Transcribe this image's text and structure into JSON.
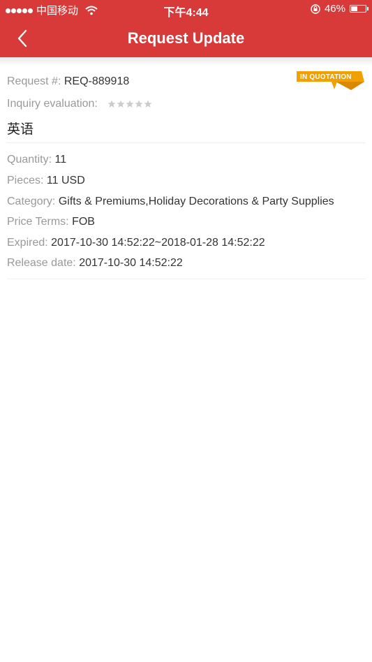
{
  "status_bar": {
    "carrier": "中国移动",
    "time": "下午4:44",
    "battery_percent": "46%",
    "battery_level": 0.46,
    "icons": [
      "signal-dots-icon",
      "wifi-icon",
      "rotation-lock-icon",
      "battery-icon"
    ]
  },
  "nav": {
    "title": "Request Update",
    "back_icon": "chevron-left-icon"
  },
  "request": {
    "badge": "IN QUOTATION",
    "number_label": "Request #:",
    "number_value": "REQ-889918",
    "evaluation_label": "Inquiry evaluation:",
    "evaluation_rating": 0,
    "evaluation_max": 5,
    "title": "英语"
  },
  "details": {
    "quantity_label": "Quantity:",
    "quantity_value": "11",
    "pieces_label": "Pieces:",
    "pieces_value": "11 USD",
    "category_label": "Category:",
    "category_value": "Gifts & Premiums,Holiday Decorations & Party Supplies",
    "price_terms_label": "Price Terms:",
    "price_terms_value": "FOB",
    "expired_label": "Expired:",
    "expired_value": "2017-10-30 14:52:22~2018-01-28 14:52:22",
    "release_label": "Release date:",
    "release_value": "2017-10-30 14:52:22"
  },
  "colors": {
    "header": "#d83a3a",
    "badge": "#f0a000",
    "label": "#999999",
    "value": "#333333",
    "star_empty": "#cccccc"
  }
}
